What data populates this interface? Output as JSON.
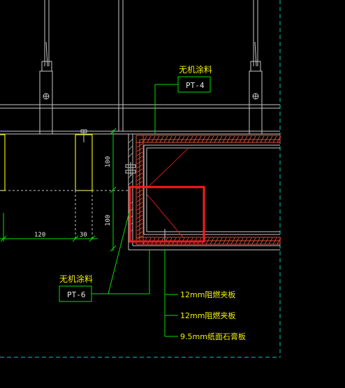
{
  "colors": {
    "background": "#000000",
    "line_white": "#c8c8c8",
    "line_green": "#00e000",
    "line_cyan": "#00c8c8",
    "line_yellow": "#e8e800",
    "line_red": "#ff2020",
    "hatch": "#e0503c",
    "highlight_red": "#ff1a1a",
    "text_yellow": "#f0f000",
    "text_white": "#e8e8e8"
  },
  "callouts": {
    "top_material": "无机涂料",
    "top_code": "PT-4",
    "left_material": "无机涂料",
    "left_code": "PT-6"
  },
  "dimensions": {
    "vertical_upper": "100",
    "vertical_lower": "100",
    "horizontal_a": "120",
    "horizontal_b": "30"
  },
  "layer_notes": [
    "12mm阻燃夹板",
    "12mm阻燃夹板",
    "9.5mm纸面石膏板"
  ]
}
